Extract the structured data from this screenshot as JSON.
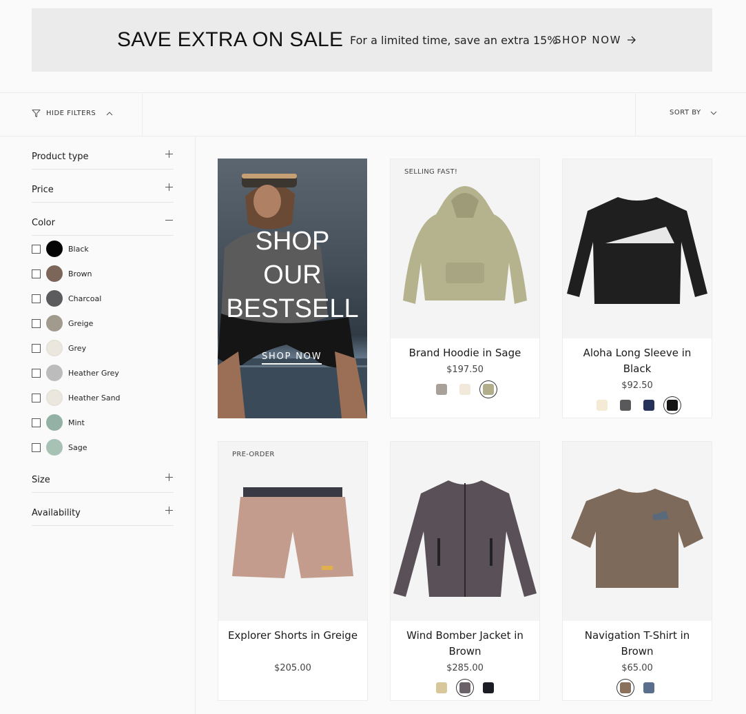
{
  "promo": {
    "title": "SAVE EXTRA ON SALE",
    "text": "For a limited time, save an extra 15%",
    "cta": "SHOP NOW"
  },
  "toolbar": {
    "hide_filters": "HIDE FILTERS",
    "sort_by": "SORT BY"
  },
  "filters": {
    "product_type": "Product type",
    "price": "Price",
    "color": "Color",
    "size": "Size",
    "availability": "Availability",
    "colors": [
      {
        "name": "Black",
        "hex": "#050505"
      },
      {
        "name": "Brown",
        "hex": "#7b6659"
      },
      {
        "name": "Charcoal",
        "hex": "#5c5b5d"
      },
      {
        "name": "Greige",
        "hex": "#a19b8e"
      },
      {
        "name": "Grey",
        "hex": "#ebe7de"
      },
      {
        "name": "Heather Grey",
        "hex": "#bcbcbc"
      },
      {
        "name": "Heather Sand",
        "hex": "#ebe7de"
      },
      {
        "name": "Mint",
        "hex": "#93b2a5"
      },
      {
        "name": "Sage",
        "hex": "#a7c2b4"
      }
    ]
  },
  "hero": {
    "headline": [
      "SHOP",
      "OUR",
      "BESTSELL"
    ],
    "cta": "SHOP NOW"
  },
  "products": [
    {
      "badge": "SELLING FAST!",
      "title": "Brand Hoodie in Sage",
      "price": "$197.50",
      "swatches": [
        "#a8a19a",
        "#f1e9d9",
        "#b2ae8c"
      ],
      "active_swatch": 2
    },
    {
      "badge": "",
      "title": "Aloha Long Sleeve in Black",
      "price": "$92.50",
      "swatches": [
        "#f4ead6",
        "#59595b",
        "#26325a",
        "#151515"
      ],
      "active_swatch": 3
    },
    {
      "badge": "PRE-ORDER",
      "title": "Explorer Shorts in Greige",
      "price": "$205.00",
      "swatches": [],
      "active_swatch": -1
    },
    {
      "badge": "",
      "title": "Wind Bomber Jacket in Brown",
      "price": "$285.00",
      "swatches": [
        "#d7c79a",
        "#6a6268",
        "#1b1c24"
      ],
      "active_swatch": 1
    },
    {
      "badge": "",
      "title": "Navigation T-Shirt in Brown",
      "price": "$65.00",
      "swatches": [
        "#8a715e",
        "#5a6f8c"
      ],
      "active_swatch": 0
    }
  ]
}
